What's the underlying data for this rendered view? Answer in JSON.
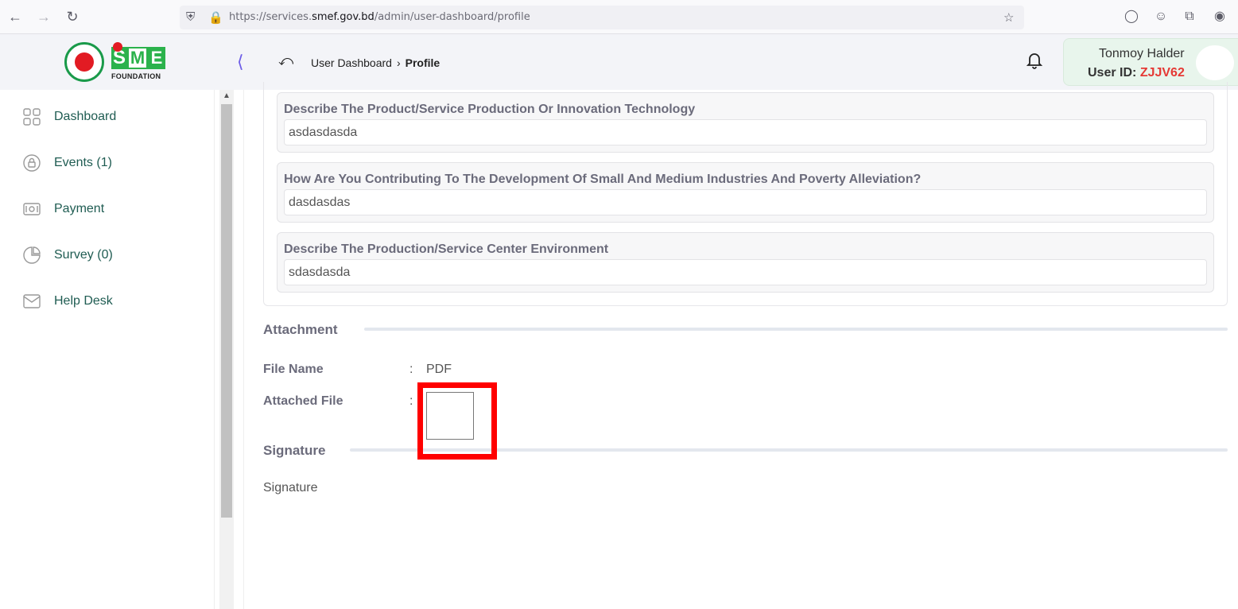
{
  "browser": {
    "url_prefix": "https://services.",
    "url_domain": "smef.gov.bd",
    "url_path": "/admin/user-dashboard/profile"
  },
  "header": {
    "logo_text": "SME",
    "logo_sub": "FOUNDATION",
    "breadcrumb_parent": "User Dashboard",
    "breadcrumb_current": "Profile",
    "user_name": "Tonmoy Halder",
    "user_id_label": "User ID:",
    "user_id_value": "ZJJV62"
  },
  "sidebar": {
    "items": [
      {
        "label": "Dashboard",
        "icon": "grid-icon"
      },
      {
        "label": "Events (1)",
        "icon": "lock-circle-icon"
      },
      {
        "label": "Payment",
        "icon": "money-icon"
      },
      {
        "label": "Survey (0)",
        "icon": "pie-chart-icon"
      },
      {
        "label": "Help Desk",
        "icon": "mail-icon"
      }
    ]
  },
  "main": {
    "questions": [
      {
        "question": "Describe The Product/Service Production Or Innovation Technology",
        "answer": "asdasdasda"
      },
      {
        "question": "How Are You Contributing To The Development Of Small And Medium Industries And Poverty Alleviation?",
        "answer": "dasdasdas"
      },
      {
        "question": "Describe The Production/Service Center Environment",
        "answer": "sdasdasda"
      }
    ],
    "attachment": {
      "title": "Attachment",
      "file_name_label": "File Name",
      "file_name_value": "PDF",
      "attached_file_label": "Attached File",
      "colon": ":"
    },
    "signature": {
      "title": "Signature",
      "text": "Signature"
    }
  },
  "colors": {
    "accent_green": "#2bb24c",
    "accent_red": "#e53935",
    "highlight": "#ff0000"
  }
}
